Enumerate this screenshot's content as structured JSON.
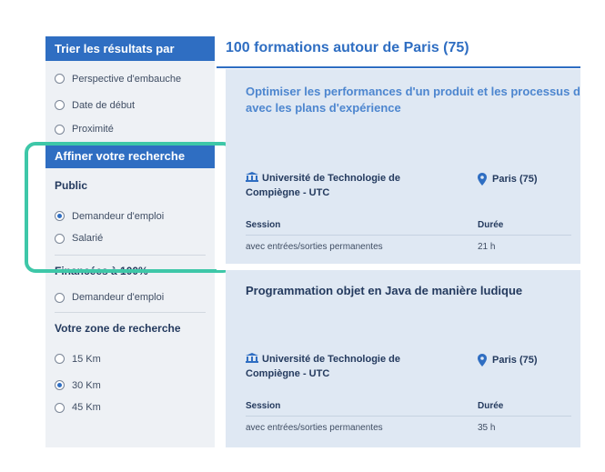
{
  "sidebar": {
    "sort_header": "Trier les résultats par",
    "sort_options": [
      {
        "label": "Perspective d'embauche",
        "selected": false
      },
      {
        "label": "Date de début",
        "selected": false
      },
      {
        "label": "Proximité",
        "selected": false
      }
    ],
    "refine_header": "Affiner votre recherche",
    "public": {
      "title": "Public",
      "options": [
        {
          "label": "Demandeur d'emploi",
          "selected": true
        },
        {
          "label": "Salarié",
          "selected": false
        }
      ]
    },
    "financed": {
      "title": "Financées à 100%",
      "options": [
        {
          "label": "Demandeur d'emploi",
          "selected": false
        }
      ]
    },
    "zone": {
      "title": "Votre zone de recherche",
      "options": [
        {
          "label": "15 Km",
          "selected": false
        },
        {
          "label": "30 Km",
          "selected": true
        },
        {
          "label": "45 Km",
          "selected": false
        }
      ]
    }
  },
  "main": {
    "title": "100 formations autour de Paris (75)",
    "results": [
      {
        "title_line1": "Optimiser les performances d'un produit et les processus d",
        "title_line2": "avec les plans d'expérience",
        "org_line1": "Université de Technologie de",
        "org_line2": "Compiègne - UTC",
        "location": "Paris (75)",
        "session_label": "Session",
        "session_value": "avec entrées/sorties permanentes",
        "duration_label": "Durée",
        "duration_value": "21 h"
      },
      {
        "title_line1": "Programmation objet en Java de manière ludique",
        "org_line1": "Université de Technologie de",
        "org_line2": "Compiègne - UTC",
        "location": "Paris (75)",
        "session_label": "Session",
        "session_value": "avec entrées/sorties permanentes",
        "duration_label": "Durée",
        "duration_value": "35 h"
      }
    ]
  },
  "colors": {
    "accent": "#2f6ec2",
    "highlight": "#3ec7a8",
    "card_bg": "#dfe8f3",
    "sidebar_bg": "#eef1f5"
  },
  "icons": {
    "org": "university-icon",
    "location": "map-pin-icon"
  }
}
